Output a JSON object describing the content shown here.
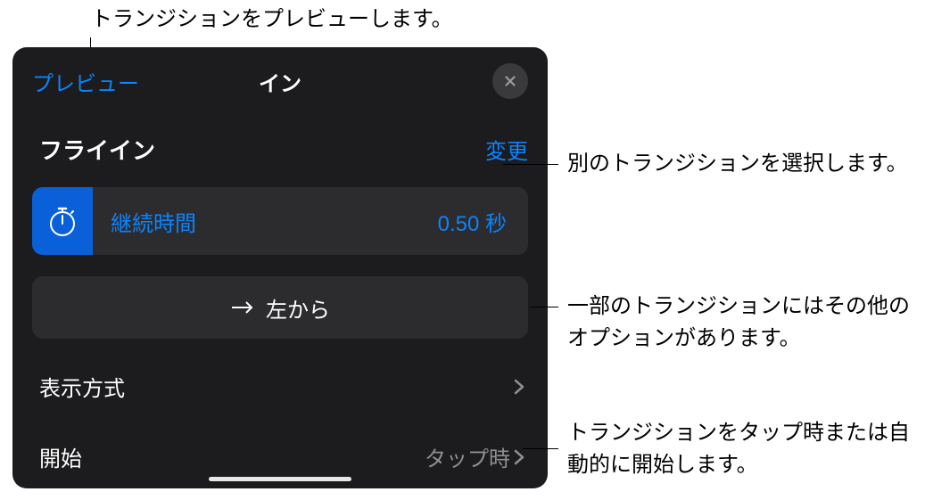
{
  "annotations": {
    "preview": "トランジションをプレビューします。",
    "change": "別のトランジションを選択します。",
    "direction": "一部のトランジションにはその他のオプションがあります。",
    "start": "トランジションをタップ時または自動的に開始します。"
  },
  "header": {
    "preview_label": "プレビュー",
    "title": "イン"
  },
  "transition": {
    "name": "フライイン",
    "change_label": "変更"
  },
  "duration": {
    "label": "継続時間",
    "value": "0.50 秒"
  },
  "direction": {
    "label": "左から"
  },
  "display_method": {
    "label": "表示方式"
  },
  "start": {
    "label": "開始",
    "value": "タップ時"
  }
}
